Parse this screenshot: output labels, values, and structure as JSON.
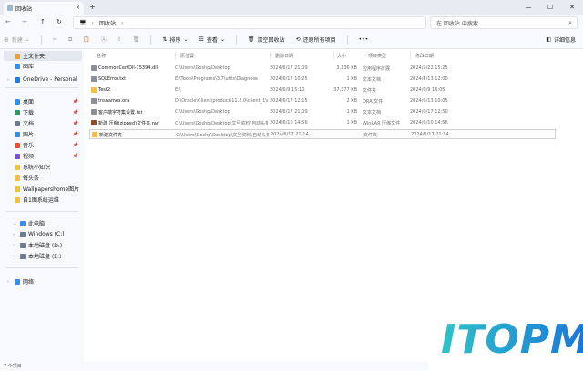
{
  "window": {
    "tab_title": "回收站",
    "tab_close": "×",
    "new_tab": "+",
    "minimize": "—",
    "maximize": "☐",
    "close": "✕"
  },
  "address": {
    "back": "←",
    "forward": "→",
    "up": "↑",
    "refresh": "↻",
    "pc_icon": "🖥",
    "sep": "›",
    "crumb": "回收站",
    "more": "›",
    "search_placeholder": "在 回收站 中搜索",
    "search_icon": "⌕"
  },
  "toolbar": {
    "new_label": "新建",
    "sort_label": "排序",
    "view_label": "查看",
    "empty_bin_label": "清空回收站",
    "restore_all_label": "还原所有项目",
    "more_label": "•••",
    "details_label": "详细信息"
  },
  "sidebar": {
    "items": [
      {
        "label": "主文件夹",
        "icon": "home-icon",
        "color": "#e4a23a",
        "pinned": false
      },
      {
        "label": "图库",
        "icon": "gallery-icon",
        "color": "#3b8fe0",
        "pinned": false
      },
      {
        "label": "OneDrive - Personal",
        "icon": "onedrive-icon",
        "color": "#2b7cd3",
        "pinned": false
      },
      {
        "label": "桌面",
        "icon": "desktop-icon",
        "color": "#3a8ee6",
        "pinned": true
      },
      {
        "label": "下载",
        "icon": "download-icon",
        "color": "#2f9a5b",
        "pinned": true
      },
      {
        "label": "文档",
        "icon": "documents-icon",
        "color": "#6b7c93",
        "pinned": true
      },
      {
        "label": "图片",
        "icon": "pictures-icon",
        "color": "#3a8ee6",
        "pinned": true
      },
      {
        "label": "音乐",
        "icon": "music-icon",
        "color": "#e0562d",
        "pinned": true
      },
      {
        "label": "视频",
        "icon": "videos-icon",
        "color": "#7a4fd6",
        "pinned": true
      },
      {
        "label": "系统小知识",
        "icon": "folder-icon",
        "color": "#f3c044",
        "pinned": false
      },
      {
        "label": "每头条",
        "icon": "folder-icon",
        "color": "#f3c044",
        "pinned": false
      },
      {
        "label": "Wallpapershome图片",
        "icon": "folder-icon",
        "color": "#f3c044",
        "pinned": false
      },
      {
        "label": "自1图系统运维",
        "icon": "folder-icon",
        "color": "#f3c044",
        "pinned": false
      },
      {
        "label": "此电脑",
        "icon": "this-pc-icon",
        "color": "#3a8ee6",
        "pinned": false
      },
      {
        "label": "Windows (C:)",
        "icon": "drive-icon",
        "color": "#6b7c93",
        "pinned": false
      },
      {
        "label": "本地磁盘 (D:)",
        "icon": "drive-icon",
        "color": "#6b7c93",
        "pinned": false
      },
      {
        "label": "本地磁盘 (E:)",
        "icon": "drive-icon",
        "color": "#6b7c93",
        "pinned": false
      },
      {
        "label": "网络",
        "icon": "network-icon",
        "color": "#3a8ee6",
        "pinned": false
      }
    ]
  },
  "table": {
    "headers": [
      "名称",
      "原位置",
      "删除日期",
      "大小",
      "项目类型",
      "修改日期"
    ],
    "rows": [
      {
        "name": "CommonCertDll-15394.dll",
        "icon": "dll-file-icon",
        "color": "#8a8f98",
        "location": "C:\\Users\\Goshp\\Desktop",
        "deleted": "2024/6/17 21:09",
        "size": "3,136 KB",
        "type": "应用程序扩展",
        "modified": "2024/5/22 15:25"
      },
      {
        "name": "SQLError.txt",
        "icon": "txt-file-icon",
        "color": "#8a8f98",
        "location": "E:\\Tools\\Programs\\3.7\\utils\\Diagnose",
        "deleted": "2024/6/17 10:25",
        "size": "1 KB",
        "type": "文本文档",
        "modified": "2024/4/13 12:00"
      },
      {
        "name": "Test2",
        "icon": "folder-icon",
        "color": "#f3c044",
        "location": "E:\\",
        "deleted": "2024/6/9 15:10",
        "size": "37,377 KB",
        "type": "文件夹",
        "modified": "2024/6/9 16:05"
      },
      {
        "name": "tnsnames.ora",
        "icon": "ora-file-icon",
        "color": "#8a8f98",
        "location": "D:\\Oracle\\Client\\product\\11.2.0\\client_1\\ne...",
        "deleted": "2024/6/17 12:15",
        "size": "2 KB",
        "type": "ORA 文件",
        "modified": "2024/6/13 10:05"
      },
      {
        "name": "客户端字符集设置.txt",
        "icon": "txt-file-icon",
        "color": "#8a8f98",
        "location": "C:\\Users\\Goshp\\Desktop",
        "deleted": "2024/6/17 21:09",
        "size": "1 KB",
        "type": "文本文档",
        "modified": "2024/6/17 12:50"
      },
      {
        "name": "新建 压缩(zipped)文件夹.rar",
        "icon": "rar-file-icon",
        "color": "#8c4b2a",
        "location": "C:\\Users\\Goshp\\Desktop\\文旦资料\\自动头条\\20...",
        "deleted": "2024/6/10 14:56",
        "size": "1 KB",
        "type": "WinRAR 压缩文件",
        "modified": "2024/6/10 14:56"
      },
      {
        "name": "新建文件夹",
        "icon": "folder-icon",
        "color": "#f3c044",
        "location": "C:\\Users\\Goshp\\Desktop\\文旦资料\\自动头条\\20...",
        "deleted": "2024/6/17 21:14",
        "size": "",
        "type": "文件夹",
        "modified": "2024/6/17 21:14"
      }
    ]
  },
  "status": {
    "count": "7 个项目"
  },
  "watermark": {
    "text": "ITOPM",
    "color_start": "#2fc3c9",
    "color_end": "#1a73d9"
  }
}
